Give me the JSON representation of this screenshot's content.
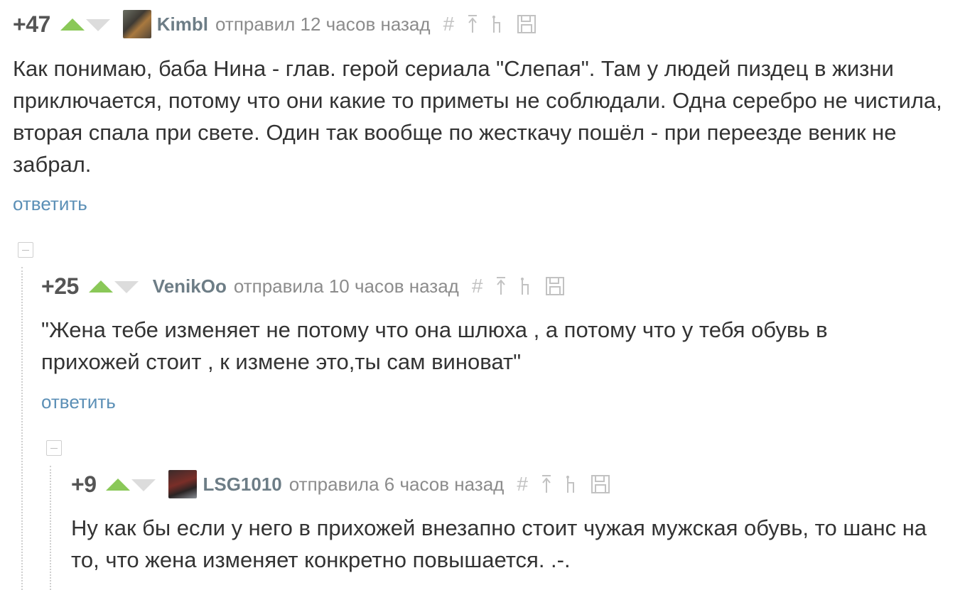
{
  "comments": [
    {
      "rating": "+47",
      "author": "Kimbl",
      "meta": "отправил 12 часов назад",
      "body": "Как понимаю, баба Нина - глав. герой сериала \"Слепая\". Там у людей пиздец в жизни приключается, потому что они какие то приметы не соблюдали. Одна серебро не чистила, вторая спала при свете. Один так вообще по жесткачу пошёл - при переезде веник не забрал.",
      "reply": "ответить",
      "icons": [
        "hash-icon",
        "arrow-up-icon",
        "tree-icon",
        "save-icon"
      ]
    },
    {
      "rating": "+25",
      "author": "VenikOo",
      "meta": "отправила 10 часов назад",
      "body": "\"Жена тебе изменяет не потому что она шлюха , а потому что у тебя обувь в прихожей стоит , к измене это,ты сам виноват\"",
      "reply": "ответить",
      "icons": [
        "hash-icon",
        "arrow-up-icon",
        "tree-icon",
        "save-icon"
      ]
    },
    {
      "rating": "+9",
      "author": "LSG1010",
      "meta": "отправила 6 часов назад",
      "body": "Ну как бы если у него в прихожей внезапно стоит чужая мужская обувь, то шанс на то, что жена изменяет конкретно повышается. .-.",
      "icons": [
        "hash-icon",
        "arrow-up-icon",
        "tree-icon",
        "save-icon"
      ]
    }
  ],
  "tool_glyphs": {
    "hash": "#"
  },
  "colors": {
    "vote_up": "#8ac858",
    "vote_down": "#dcdcdc",
    "author": "#6d7d86",
    "reply": "#5b8fb6",
    "meta": "#8c8c8c"
  }
}
